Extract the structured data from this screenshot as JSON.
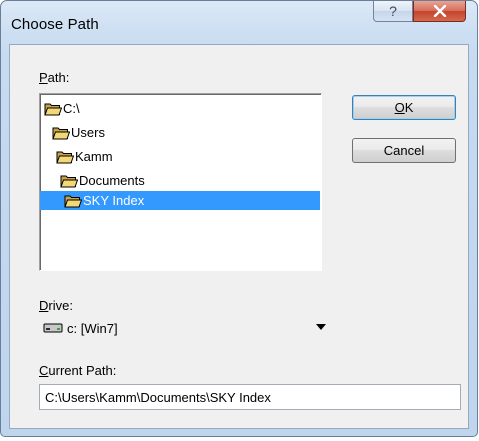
{
  "window": {
    "title": "Choose Path"
  },
  "caption_buttons": {
    "help_glyph": "?",
    "close_glyph": "x"
  },
  "labels": {
    "path": "Path:",
    "drive": "Drive:",
    "current_path": "Current Path:"
  },
  "tree": {
    "items": [
      {
        "label": "C:\\",
        "state": "open",
        "selected": false
      },
      {
        "label": "Users",
        "state": "open",
        "selected": false
      },
      {
        "label": "Kamm",
        "state": "open",
        "selected": false
      },
      {
        "label": "Documents",
        "state": "open",
        "selected": false
      },
      {
        "label": "SKY Index",
        "state": "open",
        "selected": true
      }
    ]
  },
  "buttons": {
    "ok": "OK",
    "cancel": "Cancel"
  },
  "drive": {
    "selected": "c: [Win7]",
    "icon": "drive-icon"
  },
  "current_path": {
    "value": "C:\\Users\\Kamm\\Documents\\SKY Index"
  },
  "colors": {
    "selection": "#3399ff",
    "client": "#f0f0f0",
    "close": "#c5432c"
  }
}
